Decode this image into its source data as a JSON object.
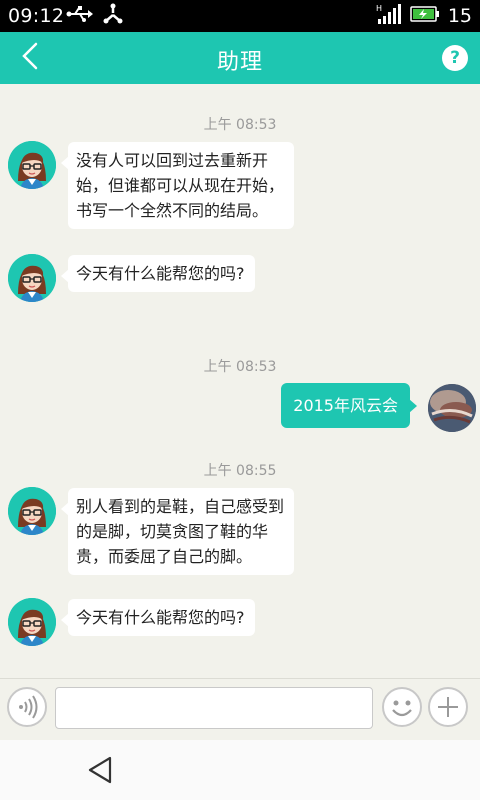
{
  "status_bar": {
    "time": "09:12",
    "battery_level": "15",
    "icons_left": [
      "usb-icon",
      "usb-debug-icon"
    ],
    "icons_right": [
      "signal-icon",
      "battery-charging-icon"
    ],
    "signal_label": "H"
  },
  "header": {
    "title": "助理",
    "help_label": "?",
    "background": "#1ec6b1"
  },
  "messages": [
    {
      "type": "timestamp",
      "text": "上午 08:53"
    },
    {
      "type": "bot",
      "lines": [
        "没有人可以回到过去重新开",
        "始，但谁都可以从现在开始，",
        "书写一个全然不同的结局。"
      ]
    },
    {
      "type": "bot",
      "lines": [
        "今天有什么能帮您的吗?"
      ]
    },
    {
      "type": "timestamp",
      "text": "上午 08:53"
    },
    {
      "type": "user",
      "lines": [
        "2015年风云会"
      ]
    },
    {
      "type": "timestamp",
      "text": "上午 08:55"
    },
    {
      "type": "bot",
      "lines": [
        "别人看到的是鞋，自己感受到",
        "的是脚，切莫贪图了鞋的华",
        "贵，而委屈了自己的脚。"
      ]
    },
    {
      "type": "bot",
      "lines": [
        "今天有什么能帮您的吗?"
      ]
    }
  ],
  "input_bar": {
    "value": "",
    "placeholder": ""
  },
  "colors": {
    "accent": "#1ec6b1",
    "background": "#f2f2eb",
    "timestamp": "#9a9a9a"
  }
}
